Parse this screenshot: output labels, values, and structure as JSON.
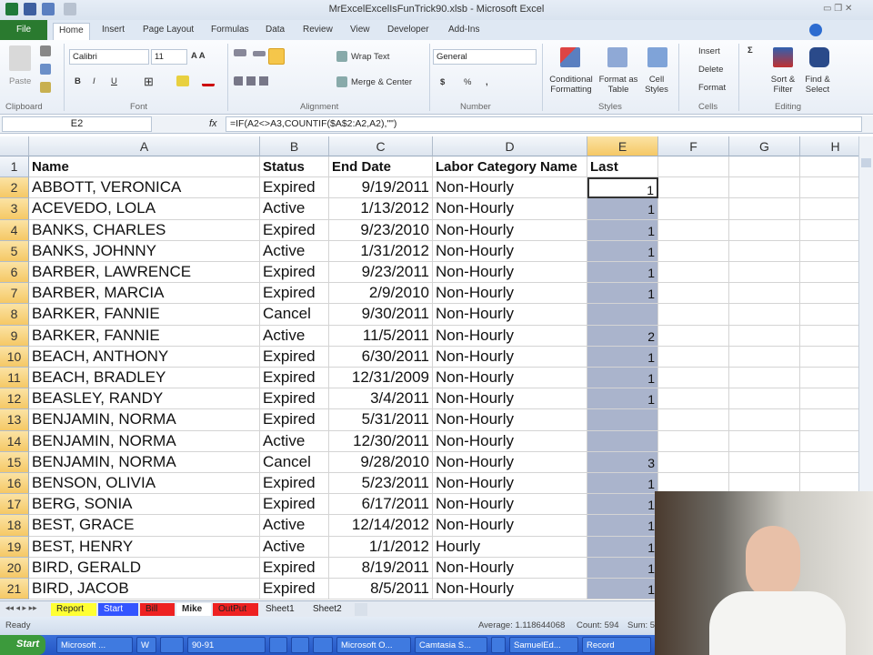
{
  "window": {
    "title": "MrExcelExcelIsFunTrick90.xlsb - Microsoft Excel"
  },
  "tabs": [
    "File",
    "Home",
    "Insert",
    "Page Layout",
    "Formulas",
    "Data",
    "Review",
    "View",
    "Developer",
    "Add-Ins"
  ],
  "ribbon": {
    "clipboard": {
      "paste": "Paste",
      "group": "Clipboard"
    },
    "font": {
      "name": "Calibri",
      "size": "11",
      "bold": "B",
      "italic": "I",
      "underline": "U",
      "group": "Font"
    },
    "alignment": {
      "wrap": "Wrap Text",
      "merge": "Merge & Center",
      "group": "Alignment"
    },
    "number": {
      "format": "General",
      "currency": "$",
      "percent": "%",
      "comma": ",",
      "group": "Number"
    },
    "styles": {
      "conditional": "Conditional Formatting",
      "format_table": "Format as Table",
      "cell_styles": "Cell Styles",
      "group": "Styles"
    },
    "cells": {
      "insert": "Insert",
      "delete": "Delete",
      "format": "Format",
      "group": "Cells"
    },
    "editing": {
      "sum": "Σ",
      "sort": "Sort & Filter",
      "find": "Find & Select",
      "group": "Editing"
    }
  },
  "formula_bar": {
    "name_box": "E2",
    "fx": "fx",
    "formula": "=IF(A2<>A3,COUNTIF($A$2:A2,A2),\"\")"
  },
  "columns": [
    "A",
    "B",
    "C",
    "D",
    "E",
    "F",
    "G",
    "H"
  ],
  "headers": [
    "Name",
    "Status",
    "End Date",
    "Labor Category Name",
    "Last"
  ],
  "rows": [
    [
      "ABBOTT, VERONICA",
      "Expired",
      "9/19/2011",
      "Non-Hourly",
      "1"
    ],
    [
      "ACEVEDO, LOLA",
      "Active",
      "1/13/2012",
      "Non-Hourly",
      "1"
    ],
    [
      "BANKS, CHARLES",
      "Expired",
      "9/23/2010",
      "Non-Hourly",
      "1"
    ],
    [
      "BANKS, JOHNNY",
      "Active",
      "1/31/2012",
      "Non-Hourly",
      "1"
    ],
    [
      "BARBER, LAWRENCE",
      "Expired",
      "9/23/2011",
      "Non-Hourly",
      "1"
    ],
    [
      "BARBER, MARCIA",
      "Expired",
      "2/9/2010",
      "Non-Hourly",
      "1"
    ],
    [
      "BARKER, FANNIE",
      "Cancel",
      "9/30/2011",
      "Non-Hourly",
      ""
    ],
    [
      "BARKER, FANNIE",
      "Active",
      "11/5/2011",
      "Non-Hourly",
      "2"
    ],
    [
      "BEACH, ANTHONY",
      "Expired",
      "6/30/2011",
      "Non-Hourly",
      "1"
    ],
    [
      "BEACH, BRADLEY",
      "Expired",
      "12/31/2009",
      "Non-Hourly",
      "1"
    ],
    [
      "BEASLEY, RANDY",
      "Expired",
      "3/4/2011",
      "Non-Hourly",
      "1"
    ],
    [
      "BENJAMIN, NORMA",
      "Expired",
      "5/31/2011",
      "Non-Hourly",
      ""
    ],
    [
      "BENJAMIN, NORMA",
      "Active",
      "12/30/2011",
      "Non-Hourly",
      ""
    ],
    [
      "BENJAMIN, NORMA",
      "Cancel",
      "9/28/2010",
      "Non-Hourly",
      "3"
    ],
    [
      "BENSON, OLIVIA",
      "Expired",
      "5/23/2011",
      "Non-Hourly",
      "1"
    ],
    [
      "BERG, SONIA",
      "Expired",
      "6/17/2011",
      "Non-Hourly",
      "1"
    ],
    [
      "BEST, GRACE",
      "Active",
      "12/14/2012",
      "Non-Hourly",
      "1"
    ],
    [
      "BEST, HENRY",
      "Active",
      "1/1/2012",
      "Hourly",
      "1"
    ],
    [
      "BIRD, GERALD",
      "Expired",
      "8/19/2011",
      "Non-Hourly",
      "1"
    ],
    [
      "BIRD, JACOB",
      "Expired",
      "8/5/2011",
      "Non-Hourly",
      "1"
    ]
  ],
  "sheet_tabs": [
    {
      "label": "Report",
      "color": "#ffff33"
    },
    {
      "label": "Start",
      "color": "#3355ff"
    },
    {
      "label": "Bill",
      "color": "#ee2222"
    },
    {
      "label": "Mike",
      "color": "#ffffff"
    },
    {
      "label": "OutPut",
      "color": "#ee2222"
    },
    {
      "label": "Sheet1",
      "color": "#e4eaf2"
    },
    {
      "label": "Sheet2",
      "color": "#e4eaf2"
    }
  ],
  "status": {
    "ready": "Ready",
    "average": "Average: 1.118644068",
    "count": "Count: 594",
    "sum": "Sum: 5"
  },
  "taskbar": {
    "start": "Start",
    "items": [
      "Microsoft ...",
      "W",
      "",
      "90-91",
      "",
      "",
      "",
      "Microsoft O...",
      "Camtasia S...",
      "",
      "SamuelEd...",
      "Record"
    ]
  }
}
